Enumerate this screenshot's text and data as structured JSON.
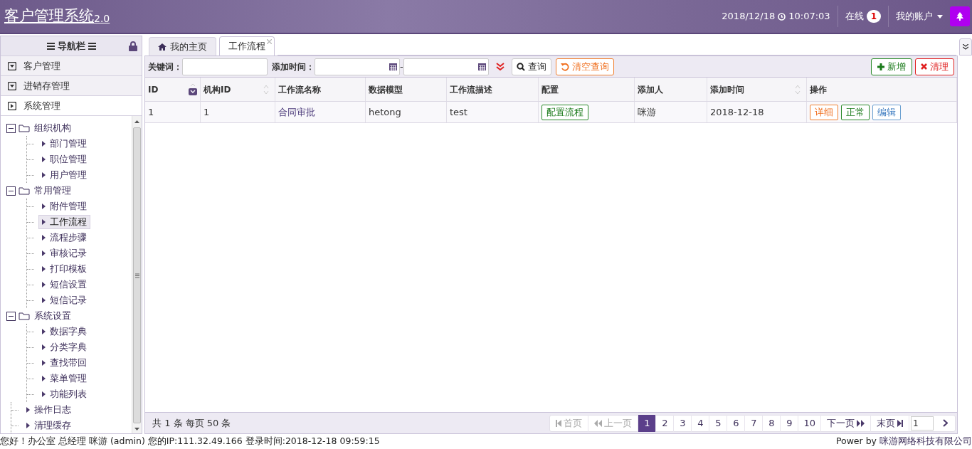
{
  "header": {
    "title": "客户管理系统",
    "version": "2.0",
    "date": "2018/12/18",
    "time": "10:07:03",
    "online_label": "在线",
    "online_count": "1",
    "account": "我的账户"
  },
  "sidebar": {
    "title": "导航栏",
    "sections": [
      {
        "label": "客户管理",
        "expanded": false
      },
      {
        "label": "进销存管理",
        "expanded": false
      },
      {
        "label": "系统管理",
        "expanded": true
      }
    ],
    "tree": [
      {
        "label": "组织机构",
        "expanded": true,
        "selected": false,
        "children": [
          {
            "label": "部门管理",
            "selected": false
          },
          {
            "label": "职位管理",
            "selected": false
          },
          {
            "label": "用户管理",
            "selected": false
          }
        ]
      },
      {
        "label": "常用管理",
        "expanded": true,
        "selected": false,
        "children": [
          {
            "label": "附件管理",
            "selected": false
          },
          {
            "label": "工作流程",
            "selected": true
          },
          {
            "label": "流程步骤",
            "selected": false
          },
          {
            "label": "审核记录",
            "selected": false
          },
          {
            "label": "打印模板",
            "selected": false
          },
          {
            "label": "短信设置",
            "selected": false
          },
          {
            "label": "短信记录",
            "selected": false
          }
        ]
      },
      {
        "label": "系统设置",
        "expanded": true,
        "selected": false,
        "children": [
          {
            "label": "数据字典",
            "selected": false
          },
          {
            "label": "分类字典",
            "selected": false
          },
          {
            "label": "查找带回",
            "selected": false
          },
          {
            "label": "菜单管理",
            "selected": false
          },
          {
            "label": "功能列表",
            "selected": false
          }
        ]
      },
      {
        "label": "操作日志",
        "selected": false
      },
      {
        "label": "清理缓存",
        "selected": false
      }
    ]
  },
  "tabs": [
    {
      "label": "我的主页",
      "selected": false,
      "kind": "home"
    },
    {
      "label": "工作流程",
      "selected": true,
      "kind": "closable"
    }
  ],
  "toolbar": {
    "keyword_label": "关键词：",
    "time_label": "添加时间：",
    "range_sep": "-",
    "search": "查询",
    "clear_search": "清空查询",
    "add": "新增",
    "cleanup": "清理"
  },
  "table": {
    "columns": [
      {
        "label": "ID",
        "sortable": true,
        "sorted": true
      },
      {
        "label": "机构ID",
        "sortable": true,
        "sorted": false
      },
      {
        "label": "工作流名称",
        "sortable": false,
        "sorted": false
      },
      {
        "label": "数据模型",
        "sortable": false,
        "sorted": false
      },
      {
        "label": "工作流描述",
        "sortable": false,
        "sorted": false
      },
      {
        "label": "配置",
        "sortable": false,
        "sorted": false
      },
      {
        "label": "添加人",
        "sortable": false,
        "sorted": false
      },
      {
        "label": "添加时间",
        "sortable": true,
        "sorted": false
      },
      {
        "label": "操作",
        "sortable": false,
        "sorted": false
      }
    ],
    "rows": [
      {
        "id": "1",
        "org_id": "1",
        "name": "合同审批",
        "model": "hetong",
        "description": "test",
        "config_button": "配置流程",
        "added_by": "咪游",
        "added_at": "2018-12-18",
        "actions": [
          "详细",
          "正常",
          "编辑"
        ]
      }
    ]
  },
  "pager": {
    "summary": "共 1 条 每页 50 条",
    "first": "首页",
    "prev": "上一页",
    "first_disabled": true,
    "prev_disabled": true,
    "pages": [
      {
        "label": "1",
        "selected": true
      },
      {
        "label": "2",
        "selected": false
      },
      {
        "label": "3",
        "selected": false
      },
      {
        "label": "4",
        "selected": false
      },
      {
        "label": "5",
        "selected": false
      },
      {
        "label": "6",
        "selected": false
      },
      {
        "label": "7",
        "selected": false
      },
      {
        "label": "8",
        "selected": false
      },
      {
        "label": "9",
        "selected": false
      },
      {
        "label": "10",
        "selected": false
      }
    ],
    "next": "下一页",
    "last": "末页",
    "page_input": "1"
  },
  "status_bar": {
    "left": "您好！办公室 总经理 咪游 (admin) 您的IP:111.32.49.166 登录时间:2018-12-18 09:59:15",
    "power_label": "Power by",
    "company": "咪游网络科技有限公司"
  }
}
